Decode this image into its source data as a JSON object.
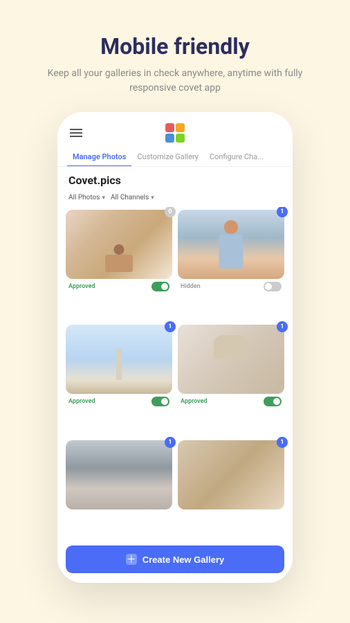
{
  "header": {
    "title": "Mobile friendly",
    "subtitle": "Keep all your galleries in check anywhere, anytime with fully responsive covet app"
  },
  "phone": {
    "logo_colors": [
      "#e85c5c",
      "#f5a623",
      "#4a90d9",
      "#7ed321"
    ],
    "nav_tabs": [
      {
        "label": "Manage Photos",
        "active": true
      },
      {
        "label": "Customize Gallery",
        "active": false
      },
      {
        "label": "Configure Cha...",
        "active": false
      }
    ],
    "gallery_title": "Covet.pics",
    "filters": [
      {
        "label": "All Photos"
      },
      {
        "label": "All Channels"
      }
    ],
    "photos": [
      {
        "id": "photo-1",
        "badge": "0",
        "badge_zero": true,
        "status": "Approved",
        "status_type": "approved",
        "toggle": "on",
        "theme": "room"
      },
      {
        "id": "photo-2",
        "badge": "1",
        "badge_zero": false,
        "status": "Hidden",
        "status_type": "hidden",
        "toggle": "off",
        "theme": "girl"
      },
      {
        "id": "photo-3",
        "badge": "1",
        "badge_zero": false,
        "status": "Approved",
        "status_type": "approved",
        "toggle": "on",
        "theme": "sky"
      },
      {
        "id": "photo-4",
        "badge": "1",
        "badge_zero": false,
        "status": "Approved",
        "status_type": "approved",
        "toggle": "on",
        "theme": "flowers"
      },
      {
        "id": "photo-5",
        "badge": "1",
        "badge_zero": false,
        "status": "",
        "status_type": "approved",
        "toggle": "on",
        "theme": "woman"
      },
      {
        "id": "photo-6",
        "badge": "1",
        "badge_zero": false,
        "status": "",
        "status_type": "approved",
        "toggle": "on",
        "theme": "table"
      }
    ],
    "create_button": {
      "label": "Create New Gallery",
      "icon": "+"
    }
  }
}
